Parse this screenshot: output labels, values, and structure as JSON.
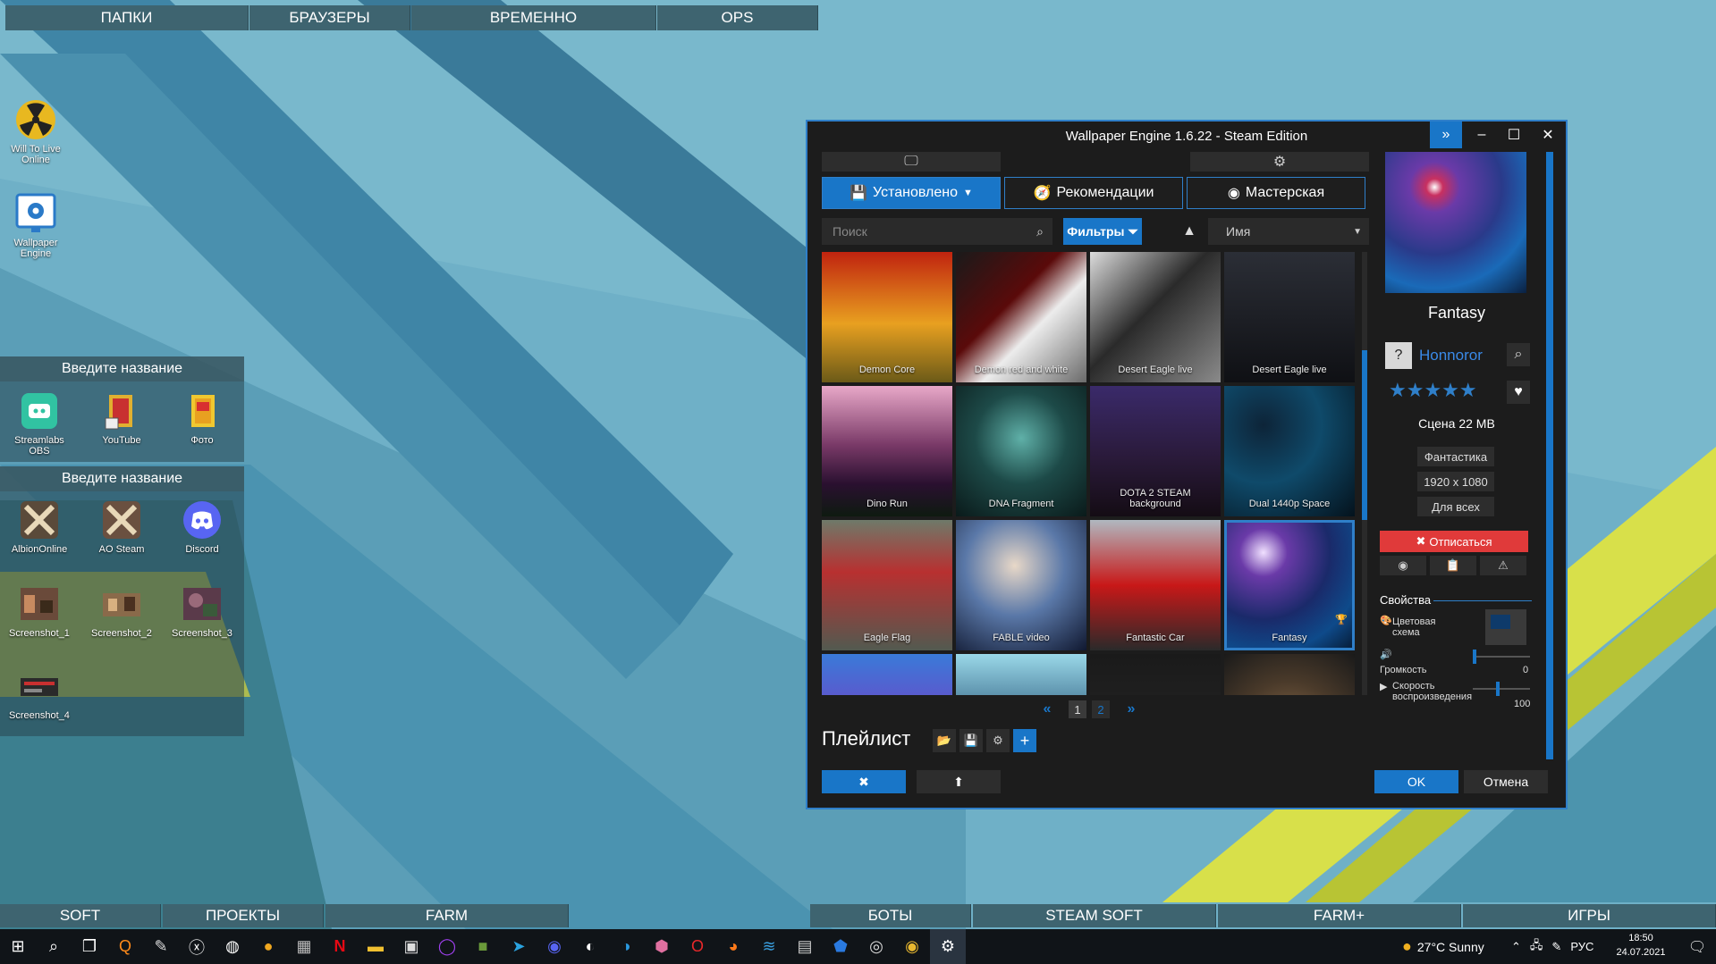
{
  "desktop": {
    "top_fences": [
      "ПАПКИ",
      "БРАУЗЕРЫ",
      "ВРЕМЕННО",
      "OPS"
    ],
    "bottom_fences": [
      "SOFT",
      "ПРОЕКТЫ",
      "FARM",
      "БОТЫ",
      "STEAM SOFT",
      "FARM+",
      "ИГРЫ"
    ],
    "loose_icons": [
      {
        "label": "Will To Live Online",
        "icon": "radiation-icon"
      },
      {
        "label": "Wallpaper Engine",
        "icon": "wallpaper-engine-icon"
      }
    ],
    "panel1": {
      "title": "Введите название",
      "icons": [
        {
          "label": "Streamlabs OBS",
          "icon": "streamlabs-icon"
        },
        {
          "label": "YouTube",
          "icon": "folder-icon"
        },
        {
          "label": "Фото",
          "icon": "folder-icon"
        }
      ]
    },
    "panel2": {
      "title": "Введите название",
      "icons": [
        {
          "label": "AlbionOnline",
          "icon": "albion-icon"
        },
        {
          "label": "AO Steam",
          "icon": "albion-icon"
        },
        {
          "label": "Discord",
          "icon": "discord-icon"
        },
        {
          "label": "Screenshot_1",
          "icon": "image-icon"
        },
        {
          "label": "Screenshot_2",
          "icon": "image-icon"
        },
        {
          "label": "Screenshot_3",
          "icon": "image-icon"
        },
        {
          "label": "Screenshot_4",
          "icon": "image-icon"
        }
      ]
    }
  },
  "window": {
    "title": "Wallpaper Engine 1.6.22 - Steam Edition",
    "tabs": [
      "Установлено",
      "Рекомендации",
      "Мастерская"
    ],
    "search_placeholder": "Поиск",
    "filters_label": "Фильтры",
    "sort_label": "Имя",
    "wallpapers": [
      {
        "label": "Demon Core",
        "bg": "linear-gradient(180deg,#c0230f 0%,#e8a020 55%,#6b5a18 100%)"
      },
      {
        "label": "Demon red and white",
        "bg": "linear-gradient(135deg,#1a1a1a 0%,#5a0a0a 40%,#ececec 60%,#6a6a6a 100%)"
      },
      {
        "label": "Desert Eagle live",
        "bg": "linear-gradient(135deg,#dcdcdc 0%,#2a2a2a 45%,#8a8a8a 100%)"
      },
      {
        "label": "Desert Eagle live",
        "bg": "linear-gradient(180deg,#2b2e36 0%,#0f1014 100%)"
      },
      {
        "label": "Dino Run",
        "bg": "linear-gradient(180deg,#e8a8c8 0%,#7a3a68 45%,#2a1030 75%,#0e1a10 100%)"
      },
      {
        "label": "DNA Fragment",
        "bg": "radial-gradient(circle at 50% 40%,#5fb0a8 0%,#1d4a48 45%,#0a1a1a 100%)"
      },
      {
        "label": "DOTA 2 STEAM background",
        "bg": "linear-gradient(180deg,#3a2a6a 0%,#2a1a3a 55%,#140c14 100%)"
      },
      {
        "label": "Dual 1440p Space",
        "bg": "radial-gradient(circle at 30% 30%,#0d2438 0%,#0f4a6a 45%,#04121c 100%)"
      },
      {
        "label": "Eagle Flag",
        "bg": "linear-gradient(180deg,#6e7a6a 0%,#b83030 40%,#525a50 100%)"
      },
      {
        "label": "FABLE video",
        "bg": "radial-gradient(circle at 45% 35%,#e8d8c8 0%,#5a78a8 45%,#101830 100%)"
      },
      {
        "label": "Fantastic Car",
        "bg": "linear-gradient(180deg,#b0b8c0 0%,#c81818 50%,#2a2a2a 100%)"
      },
      {
        "label": "Fantasy",
        "bg": "radial-gradient(circle at 30% 25%,#f0e0ff 0%,#6a3aa8 18%,#1a2a6a 50%,#0e4a8a 75%,#061830 100%)"
      },
      {
        "label": "",
        "bg": "linear-gradient(180deg,#3a7ad8 0%,#6a4ac8 50%,#3a1a6a 100%)"
      },
      {
        "label": "",
        "bg": "linear-gradient(180deg,#9ad8e8 0%,#3a6a8a 50%,#d87848 85%,#2a1a2a 100%)"
      },
      {
        "label": "",
        "bg": "linear-gradient(180deg,#1a1a1a 0%,#2a2a2a 100%)"
      },
      {
        "label": "",
        "bg": "radial-gradient(circle at 50% 60%,#8a6a4a 0%,#4a3a2a 50%,#1a1a1a 100%)"
      }
    ],
    "pages": [
      "1",
      "2"
    ],
    "playlist_label": "Плейлист",
    "selected": {
      "name": "Fantasy",
      "author": "Honnoror",
      "rating_stars": 5,
      "type_size": "Сцена 22 MB",
      "genre": "Фантастика",
      "resolution": "1920 x 1080",
      "age": "Для всех",
      "unsubscribe": "Отписаться"
    },
    "properties": {
      "header": "Свойства",
      "color_scheme": "Цветовая схема",
      "volume_label": "Громкость",
      "volume_value": "0",
      "speed_label": "Скорость воспроизведения",
      "speed_value": "100"
    },
    "ok_label": "OK",
    "cancel_label": "Отмена"
  },
  "taskbar": {
    "weather": "27°C  Sunny",
    "lang": "РУС",
    "time": "18:50",
    "date": "24.07.2021"
  },
  "colors": {
    "accent": "#1976c8",
    "danger": "#e03a3a",
    "wallpaper_bg": "#6aa7bf"
  }
}
